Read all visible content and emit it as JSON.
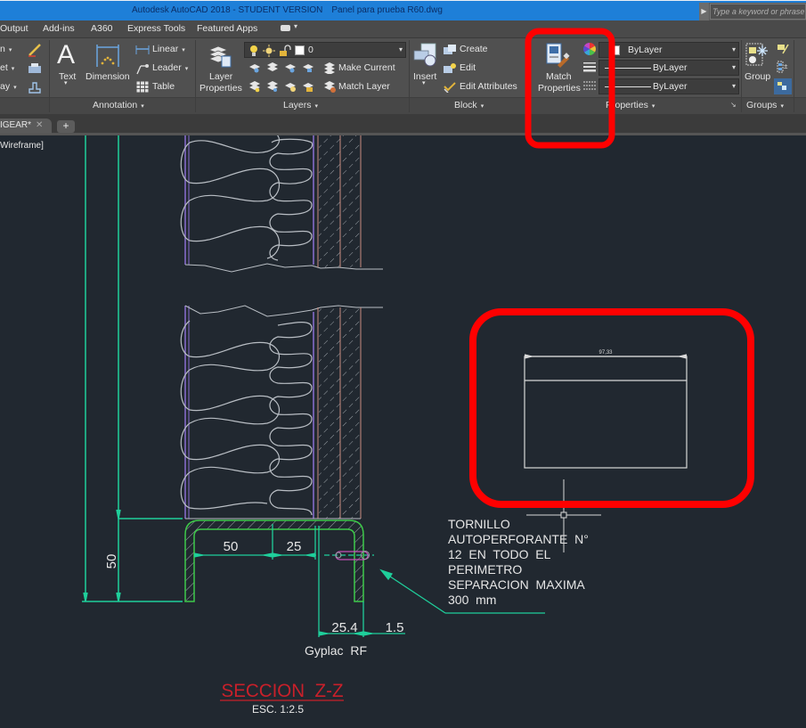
{
  "titlebar": {
    "app_title": "Autodesk AutoCAD 2018 - STUDENT VERSION",
    "file_name": "Panel para prueba R60.dwg",
    "search_placeholder": "Type a keyword or phrase"
  },
  "menu_tabs": [
    "Output",
    "Add-ins",
    "A360",
    "Express Tools",
    "Featured Apps"
  ],
  "ribbon": {
    "left_partial": {
      "items": [
        "n",
        "et",
        "ay"
      ]
    },
    "annotation": {
      "title": "Annotation",
      "text_label": "Text",
      "dimension_label": "Dimension",
      "linear_label": "Linear",
      "leader_label": "Leader",
      "table_label": "Table"
    },
    "layers": {
      "title": "Layers",
      "layer_properties_label1": "Layer",
      "layer_properties_label2": "Properties",
      "current_layer": "0",
      "make_current_label": "Make Current",
      "match_layer_label": "Match Layer"
    },
    "block": {
      "title": "Block",
      "insert_label": "Insert",
      "create_label": "Create",
      "edit_label": "Edit",
      "edit_attributes_label": "Edit Attributes"
    },
    "properties": {
      "title": "Properties",
      "match_properties_label1": "Match",
      "match_properties_label2": "Properties",
      "color_value": "ByLayer",
      "lineweight_value": "ByLayer",
      "linetype_value": "ByLayer"
    },
    "groups": {
      "title": "Groups",
      "group_label": "Group"
    }
  },
  "doc_tabs": {
    "active_tab": "IGEAR*",
    "close_glyph": "✕",
    "new_tab_glyph": "+"
  },
  "viewport": {
    "visual_style_label": "Wireframe]"
  },
  "drawing": {
    "dimensions": {
      "height_50": "50",
      "width_50": "50",
      "width_25": "25",
      "width_25_4": "25.4",
      "width_1_5": "1.5",
      "rect_width": "97,33"
    },
    "note_lines": [
      "TORNILLO",
      "AUTOPERFORANTE  N°",
      "12  EN  TODO  EL",
      "PERIMETRO",
      "SEPARACION  MAXIMA",
      "300  mm"
    ],
    "material_label": "Gyplac  RF",
    "section_title": "SECCION  Z-Z",
    "scale_label": "ESC. 1:2.5"
  },
  "colors": {
    "titlebar_blue": "#1e7fd8",
    "ribbon_bg": "#505050",
    "canvas_bg": "#212830",
    "dim_cyan": "#1fcf9b",
    "profile_green": "#3ec94a",
    "insulation_gray": "#b9bec4",
    "stud_purple": "#8a6fd1",
    "board_pink": "#c98c80",
    "section_red": "#c8202a",
    "highlight_red": "#ff0000"
  }
}
